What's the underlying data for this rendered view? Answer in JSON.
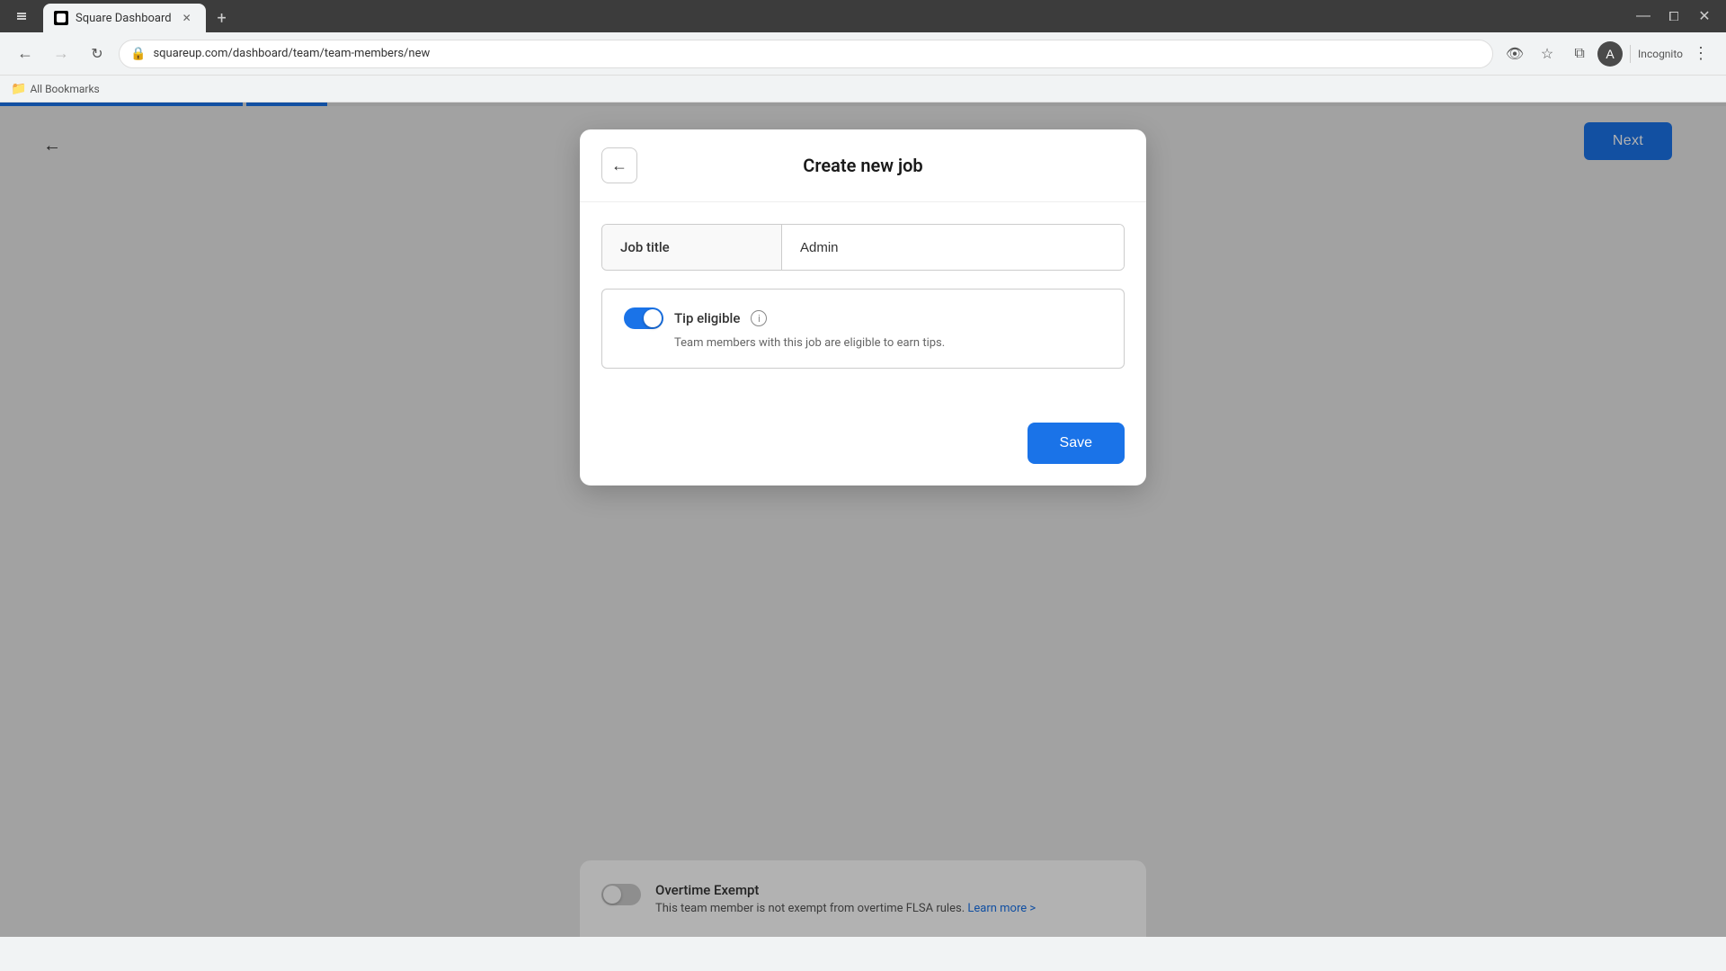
{
  "browser": {
    "tab_title": "Square Dashboard",
    "url": "squareup.com/dashboard/team/team-members/new",
    "incognito_label": "Incognito",
    "bookmarks_label": "All Bookmarks",
    "new_tab_symbol": "+"
  },
  "page": {
    "next_button_label": "Next",
    "back_arrow": "←"
  },
  "dialog": {
    "title": "Create new job",
    "back_arrow": "←",
    "job_title_label": "Job title",
    "job_title_value": "Admin",
    "job_title_placeholder": "Admin",
    "tip_eligible_label": "Tip eligible",
    "tip_eligible_desc": "Team members with this job are eligible to earn tips.",
    "save_button_label": "Save"
  },
  "background": {
    "overtime_title": "Overtime Exempt",
    "overtime_desc": "This team member is not exempt from overtime FLSA rules.",
    "learn_more_label": "Learn more >"
  },
  "icons": {
    "back": "←",
    "close": "✕",
    "info": "i",
    "shield": "🔒",
    "star": "★",
    "extension": "⊞",
    "profile": "👤",
    "eye_slash": "👁",
    "folder": "📁"
  }
}
